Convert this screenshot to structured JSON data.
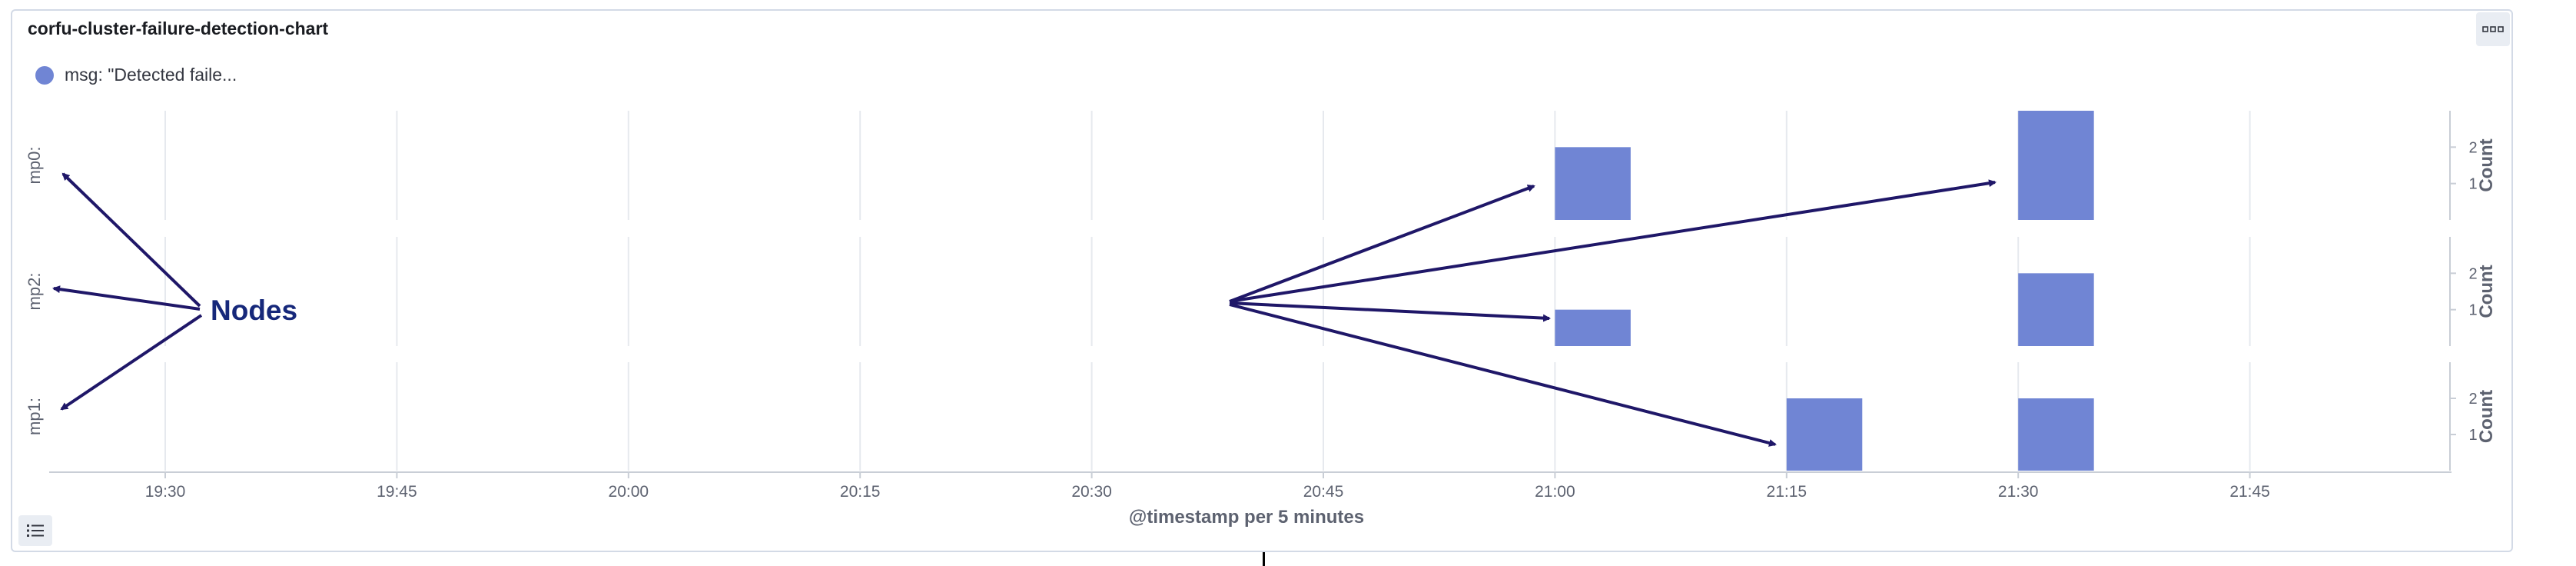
{
  "panel": {
    "title": "corfu-cluster-failure-detection-chart",
    "options_icon": "ellipsis-horizontal-icon",
    "legend_toggle_icon": "list-icon"
  },
  "legend": {
    "label": "msg: \"Detected faile..."
  },
  "annotation": {
    "label": "Nodes"
  },
  "colors": {
    "bar": "#7085d4",
    "arrow": "#1f1768",
    "annotation_text": "#16287a",
    "grid": "#e6e9ee",
    "axis_text": "#5d6270"
  },
  "chart_data": {
    "type": "bar",
    "xlabel": "@timestamp per 5 minutes",
    "ylabel": "Count",
    "x_ticks": [
      "19:30",
      "19:45",
      "20:00",
      "20:15",
      "20:30",
      "20:45",
      "21:00",
      "21:15",
      "21:30",
      "21:45"
    ],
    "y_ticks": [
      "1",
      "2"
    ],
    "ylim": [
      0,
      3
    ],
    "bar_width_minutes": 5,
    "series_name": "msg: \"Detected faile...",
    "rows": [
      {
        "label": "mp0:",
        "bars": [
          {
            "x": "21:00",
            "value": 2
          },
          {
            "x": "21:30",
            "value": 3
          }
        ]
      },
      {
        "label": "mp2:",
        "bars": [
          {
            "x": "21:00",
            "value": 1
          },
          {
            "x": "21:30",
            "value": 2
          }
        ]
      },
      {
        "label": "mp1:",
        "bars": [
          {
            "x": "21:15",
            "value": 2
          },
          {
            "x": "21:30",
            "value": 2
          }
        ]
      }
    ]
  }
}
